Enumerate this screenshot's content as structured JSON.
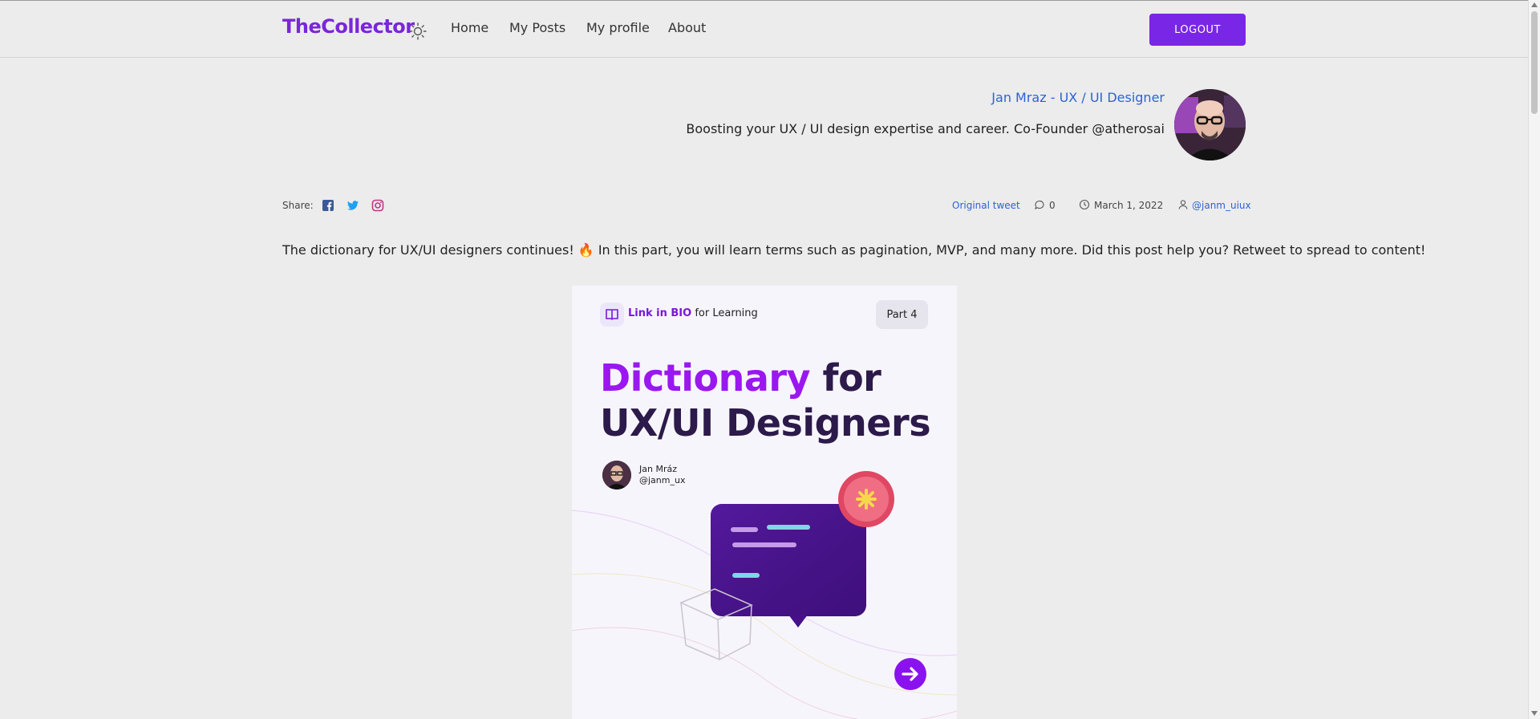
{
  "brand": "TheCollector",
  "nav": {
    "theme_icon": "sun-icon",
    "links": [
      "Home",
      "My Posts",
      "My profile",
      "About"
    ],
    "logout_label": "LOGOUT"
  },
  "author": {
    "name": "Jan Mraz - UX / UI Designer",
    "bio": "Boosting your UX / UI design expertise and career. Co-Founder @atherosai"
  },
  "share": {
    "label": "Share:",
    "icons": [
      "facebook-icon",
      "twitter-icon",
      "instagram-icon"
    ]
  },
  "meta": {
    "original_tweet": "Original tweet",
    "comments": "0",
    "date": "March 1, 2022",
    "handle": "@janm_uiux"
  },
  "post": {
    "text": "The dictionary for UX/UI designers continues! 🔥 In this part, you will learn terms such as pagination, MVP, and many more. Did this post help you? Retweet to spread to content!"
  },
  "card": {
    "logo_bold": "Link in BIO",
    "logo_rest": " for Learning",
    "part": "Part 4",
    "title_highlight": "Dictionary",
    "title_rest_1": " for",
    "title_line_2": "UX/UI Designers",
    "author_name": "Jan Mráz",
    "author_handle": "@janm_ux"
  },
  "colors": {
    "brand": "#7a26d9",
    "button": "#7a26e6",
    "link": "#2b63d6",
    "card_highlight": "#9a17f0",
    "card_title": "#2b1a4a"
  }
}
